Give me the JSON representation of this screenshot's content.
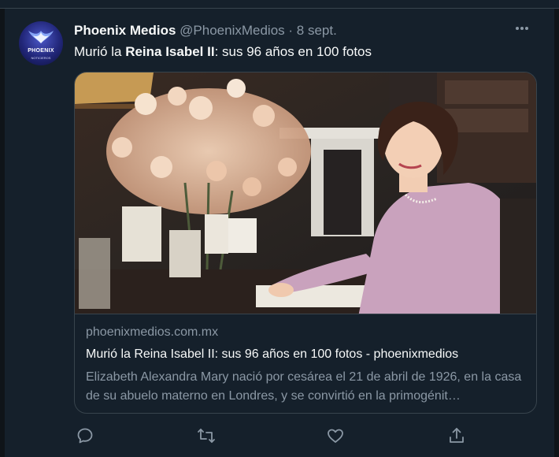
{
  "tweet": {
    "author_name": "Phoenix Medios",
    "handle": "@PhoenixMedios",
    "separator": "·",
    "date": "8 sept.",
    "text_prefix": "Murió la ",
    "text_bold": "Reina Isabel II",
    "text_suffix": ": sus 96 años en 100 fotos"
  },
  "avatar": {
    "name": "PHOENIX",
    "subtitle": "NOTICIEROS"
  },
  "card": {
    "domain": "phoenixmedios.com.mx",
    "title": "Murió la Reina Isabel II: sus 96 años en 100 fotos - phoenixmedios",
    "description": "Elizabeth Alexandra Mary nació por cesárea el 21 de abril de 1926, en la casa de su abuelo materno en Londres, y se convirtió en la primogénit…"
  },
  "icons": {
    "more": "more-horizontal-icon",
    "reply": "reply-icon",
    "retweet": "retweet-icon",
    "like": "like-icon",
    "share": "share-icon"
  },
  "colors": {
    "background": "#15202b",
    "border": "#38444d",
    "text_primary": "#f7f9f9",
    "text_secondary": "#8b98a5"
  }
}
